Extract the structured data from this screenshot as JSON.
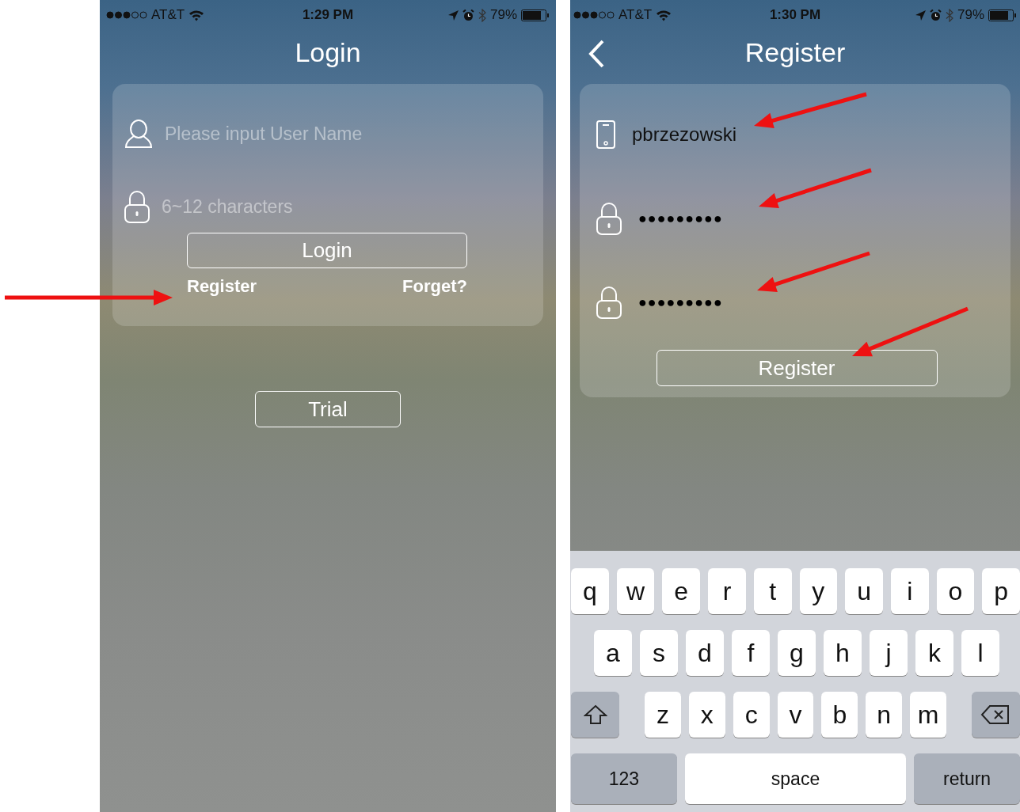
{
  "login_screen": {
    "status_bar": {
      "carrier": "AT&T",
      "time": "1:29 PM",
      "battery": "79%"
    },
    "title": "Login",
    "username_field": {
      "placeholder": "Please input User Name"
    },
    "password_field": {
      "placeholder": "6~12 characters"
    },
    "login_button": "Login",
    "register_link": "Register",
    "forget_link": "Forget?",
    "trial_button": "Trial"
  },
  "register_screen": {
    "status_bar": {
      "carrier": "AT&T",
      "time": "1:30 PM",
      "battery": "79%"
    },
    "title": "Register",
    "fields": [
      {
        "kind": "phone",
        "value": "pbrzezowski"
      },
      {
        "kind": "password",
        "value": "●●●●●●●●●"
      },
      {
        "kind": "password",
        "value": "●●●●●●●●●"
      }
    ],
    "register_button": "Register",
    "keyboard": {
      "rows": [
        [
          "q",
          "w",
          "e",
          "r",
          "t",
          "y",
          "u",
          "i",
          "o",
          "p"
        ],
        [
          "a",
          "s",
          "d",
          "f",
          "g",
          "h",
          "j",
          "k",
          "l"
        ],
        [
          "z",
          "x",
          "c",
          "v",
          "b",
          "n",
          "m"
        ]
      ],
      "numbers_key": "123",
      "space_key": "space",
      "return_key": "return"
    }
  }
}
